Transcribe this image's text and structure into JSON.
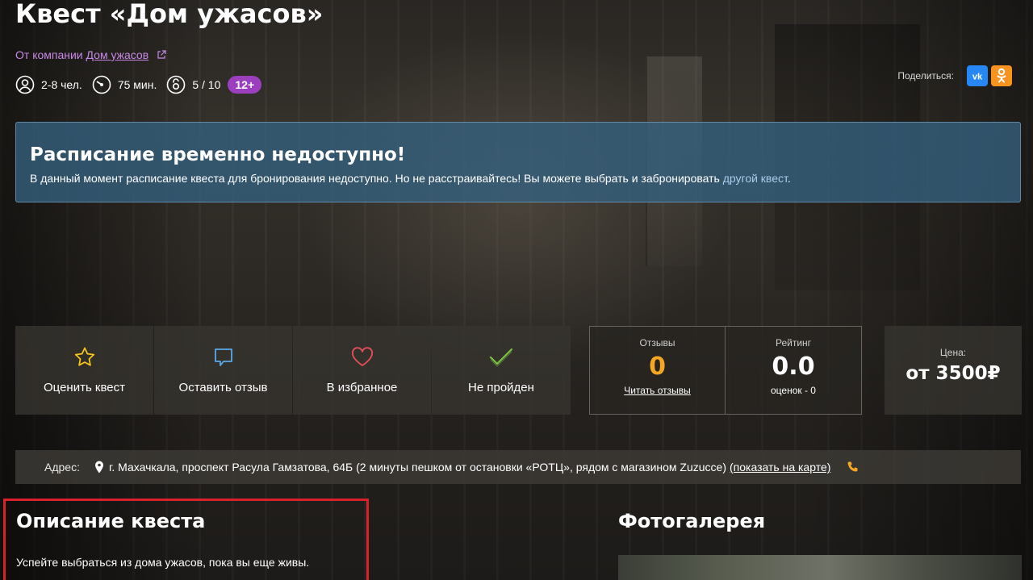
{
  "quest": {
    "title": "Квест «Дом ужасов»",
    "company_prefix": "От компании",
    "company_name": "Дом ужасов",
    "players": "2-8 чел.",
    "duration": "75 мин.",
    "difficulty": "5 / 10",
    "age": "12+"
  },
  "share": {
    "label": "Поделиться:",
    "vk_label": "vk",
    "ok_label": "ok"
  },
  "notice": {
    "title": "Расписание временно недоступно!",
    "text": "В данный момент расписание квеста для бронирования недоступно. Но не расстраивайтесь! Вы можете выбрать и забронировать",
    "link": "другой квест",
    "end": "."
  },
  "actions": [
    {
      "label": "Оценить квест",
      "icon": "star-icon"
    },
    {
      "label": "Оставить отзыв",
      "icon": "comment-icon"
    },
    {
      "label": "В избранное",
      "icon": "heart-icon"
    },
    {
      "label": "Не пройден",
      "icon": "check-icon"
    }
  ],
  "stats": {
    "reviews_caption": "Отзывы",
    "reviews_value": "0",
    "reviews_link": "Читать отзывы",
    "rating_caption": "Рейтинг",
    "rating_value": "0.0",
    "rating_sub": "оценок - 0"
  },
  "price": {
    "caption": "Цена:",
    "value": "от 3500₽"
  },
  "address": {
    "label": "Адрес:",
    "text": "г. Махачкала, проспект Расула Гамзатова, 64Б (2 минуты пешком от остановки «РОТЦ», рядом с магазином Zuzucce)",
    "map_link": "(показать на карте)"
  },
  "description": {
    "title": "Описание квеста",
    "text": "Успейте выбраться из дома ужасов, пока вы еще живы."
  },
  "gallery": {
    "title": "Фотогалерея"
  },
  "colors": {
    "accent_purple": "#9c3fbf",
    "company_link": "#c889e6",
    "notice_bg": "#346180",
    "rating_orange": "#f5a623",
    "highlight_red": "#d8212a"
  }
}
